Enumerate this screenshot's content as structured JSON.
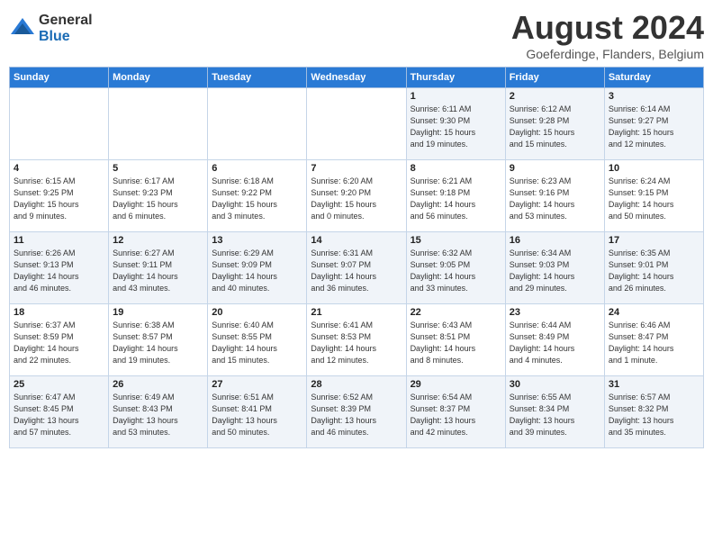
{
  "logo": {
    "general": "General",
    "blue": "Blue"
  },
  "title": "August 2024",
  "location": "Goeferdinge, Flanders, Belgium",
  "weekdays": [
    "Sunday",
    "Monday",
    "Tuesday",
    "Wednesday",
    "Thursday",
    "Friday",
    "Saturday"
  ],
  "weeks": [
    [
      {
        "day": "",
        "info": ""
      },
      {
        "day": "",
        "info": ""
      },
      {
        "day": "",
        "info": ""
      },
      {
        "day": "",
        "info": ""
      },
      {
        "day": "1",
        "info": "Sunrise: 6:11 AM\nSunset: 9:30 PM\nDaylight: 15 hours\nand 19 minutes."
      },
      {
        "day": "2",
        "info": "Sunrise: 6:12 AM\nSunset: 9:28 PM\nDaylight: 15 hours\nand 15 minutes."
      },
      {
        "day": "3",
        "info": "Sunrise: 6:14 AM\nSunset: 9:27 PM\nDaylight: 15 hours\nand 12 minutes."
      }
    ],
    [
      {
        "day": "4",
        "info": "Sunrise: 6:15 AM\nSunset: 9:25 PM\nDaylight: 15 hours\nand 9 minutes."
      },
      {
        "day": "5",
        "info": "Sunrise: 6:17 AM\nSunset: 9:23 PM\nDaylight: 15 hours\nand 6 minutes."
      },
      {
        "day": "6",
        "info": "Sunrise: 6:18 AM\nSunset: 9:22 PM\nDaylight: 15 hours\nand 3 minutes."
      },
      {
        "day": "7",
        "info": "Sunrise: 6:20 AM\nSunset: 9:20 PM\nDaylight: 15 hours\nand 0 minutes."
      },
      {
        "day": "8",
        "info": "Sunrise: 6:21 AM\nSunset: 9:18 PM\nDaylight: 14 hours\nand 56 minutes."
      },
      {
        "day": "9",
        "info": "Sunrise: 6:23 AM\nSunset: 9:16 PM\nDaylight: 14 hours\nand 53 minutes."
      },
      {
        "day": "10",
        "info": "Sunrise: 6:24 AM\nSunset: 9:15 PM\nDaylight: 14 hours\nand 50 minutes."
      }
    ],
    [
      {
        "day": "11",
        "info": "Sunrise: 6:26 AM\nSunset: 9:13 PM\nDaylight: 14 hours\nand 46 minutes."
      },
      {
        "day": "12",
        "info": "Sunrise: 6:27 AM\nSunset: 9:11 PM\nDaylight: 14 hours\nand 43 minutes."
      },
      {
        "day": "13",
        "info": "Sunrise: 6:29 AM\nSunset: 9:09 PM\nDaylight: 14 hours\nand 40 minutes."
      },
      {
        "day": "14",
        "info": "Sunrise: 6:31 AM\nSunset: 9:07 PM\nDaylight: 14 hours\nand 36 minutes."
      },
      {
        "day": "15",
        "info": "Sunrise: 6:32 AM\nSunset: 9:05 PM\nDaylight: 14 hours\nand 33 minutes."
      },
      {
        "day": "16",
        "info": "Sunrise: 6:34 AM\nSunset: 9:03 PM\nDaylight: 14 hours\nand 29 minutes."
      },
      {
        "day": "17",
        "info": "Sunrise: 6:35 AM\nSunset: 9:01 PM\nDaylight: 14 hours\nand 26 minutes."
      }
    ],
    [
      {
        "day": "18",
        "info": "Sunrise: 6:37 AM\nSunset: 8:59 PM\nDaylight: 14 hours\nand 22 minutes."
      },
      {
        "day": "19",
        "info": "Sunrise: 6:38 AM\nSunset: 8:57 PM\nDaylight: 14 hours\nand 19 minutes."
      },
      {
        "day": "20",
        "info": "Sunrise: 6:40 AM\nSunset: 8:55 PM\nDaylight: 14 hours\nand 15 minutes."
      },
      {
        "day": "21",
        "info": "Sunrise: 6:41 AM\nSunset: 8:53 PM\nDaylight: 14 hours\nand 12 minutes."
      },
      {
        "day": "22",
        "info": "Sunrise: 6:43 AM\nSunset: 8:51 PM\nDaylight: 14 hours\nand 8 minutes."
      },
      {
        "day": "23",
        "info": "Sunrise: 6:44 AM\nSunset: 8:49 PM\nDaylight: 14 hours\nand 4 minutes."
      },
      {
        "day": "24",
        "info": "Sunrise: 6:46 AM\nSunset: 8:47 PM\nDaylight: 14 hours\nand 1 minute."
      }
    ],
    [
      {
        "day": "25",
        "info": "Sunrise: 6:47 AM\nSunset: 8:45 PM\nDaylight: 13 hours\nand 57 minutes."
      },
      {
        "day": "26",
        "info": "Sunrise: 6:49 AM\nSunset: 8:43 PM\nDaylight: 13 hours\nand 53 minutes."
      },
      {
        "day": "27",
        "info": "Sunrise: 6:51 AM\nSunset: 8:41 PM\nDaylight: 13 hours\nand 50 minutes."
      },
      {
        "day": "28",
        "info": "Sunrise: 6:52 AM\nSunset: 8:39 PM\nDaylight: 13 hours\nand 46 minutes."
      },
      {
        "day": "29",
        "info": "Sunrise: 6:54 AM\nSunset: 8:37 PM\nDaylight: 13 hours\nand 42 minutes."
      },
      {
        "day": "30",
        "info": "Sunrise: 6:55 AM\nSunset: 8:34 PM\nDaylight: 13 hours\nand 39 minutes."
      },
      {
        "day": "31",
        "info": "Sunrise: 6:57 AM\nSunset: 8:32 PM\nDaylight: 13 hours\nand 35 minutes."
      }
    ]
  ]
}
